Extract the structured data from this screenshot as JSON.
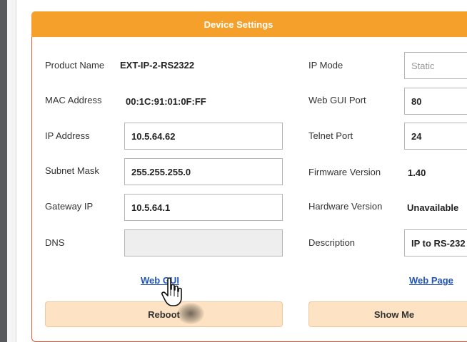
{
  "header": {
    "title": "Device Settings"
  },
  "left": {
    "product_name_label": "Product Name",
    "product_name_value": "EXT-IP-2-RS2322",
    "mac_label": "MAC Address",
    "mac_value": "00:1C:91:01:0F:FF",
    "ip_label": "IP Address",
    "ip_value": "10.5.64.62",
    "subnet_label": "Subnet Mask",
    "subnet_value": "255.255.255.0",
    "gateway_label": "Gateway IP",
    "gateway_value": "10.5.64.1",
    "dns_label": "DNS",
    "dns_value": ""
  },
  "right": {
    "ip_mode_label": "IP Mode",
    "ip_mode_value": "Static",
    "web_gui_port_label": "Web GUI Port",
    "web_gui_port_value": "80",
    "telnet_port_label": "Telnet Port",
    "telnet_port_value": "24",
    "firmware_label": "Firmware Version",
    "firmware_value": "1.40",
    "hardware_label": "Hardware Version",
    "hardware_value": "Unavailable",
    "description_label": "Description",
    "description_value": "IP to RS-232"
  },
  "links": {
    "web_gui": "Web GUI",
    "web_page": "Web Page"
  },
  "buttons": {
    "reboot": "Reboot",
    "show_me": "Show Me"
  },
  "icons": {
    "cursor": "hand-pointer-icon"
  }
}
